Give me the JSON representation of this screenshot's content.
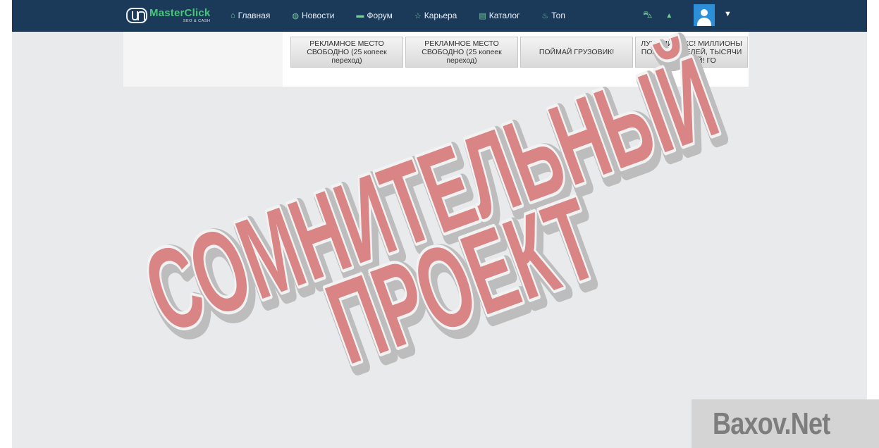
{
  "brand": {
    "name": "MasterClick",
    "tagline": "SEO & CASH"
  },
  "nav": {
    "items": [
      {
        "label": "Главная",
        "icon": "home-icon",
        "glyph": "⌂"
      },
      {
        "label": "Новости",
        "icon": "globe-icon",
        "glyph": "◍"
      },
      {
        "label": "Форум",
        "icon": "chat-icon",
        "glyph": "▬"
      },
      {
        "label": "Карьера",
        "icon": "star-icon",
        "glyph": "☆"
      },
      {
        "label": "Каталог",
        "icon": "list-icon",
        "glyph": "▤"
      },
      {
        "label": "Топ",
        "icon": "fire-icon",
        "glyph": "♨"
      }
    ],
    "right": [
      {
        "icon": "basket-icon",
        "glyph": "⛍"
      },
      {
        "icon": "bell-icon",
        "glyph": "▲"
      }
    ],
    "user_menu_caret": "▼"
  },
  "ads": [
    {
      "lines": [
        "РЕКЛАМНОЕ МЕСТО",
        "СВОБОДНО (25 копеек",
        "переход)"
      ]
    },
    {
      "lines": [
        "РЕКЛАМНОЕ МЕСТО",
        "СВОБОДНО (25 копеек",
        "переход)"
      ]
    },
    {
      "lines": [
        "ПОЙМАЙ ГРУЗОВИК!"
      ]
    },
    {
      "lines": [
        "ЛУЧШИЙ БУКС! МИЛЛИОНЫ",
        "ПОЛЬЗОВАТЕЛЕЙ, ТЫСЯЧИ",
        "ЗАДАНИЙ! ГО"
      ]
    }
  ],
  "overlay": {
    "stamp_line1": "СОМНИТЕЛЬНЫЙ",
    "stamp_line2": "ПРОЕКТ",
    "watermark": "Baxov.Net",
    "stamp_color": "#e07a7a"
  }
}
